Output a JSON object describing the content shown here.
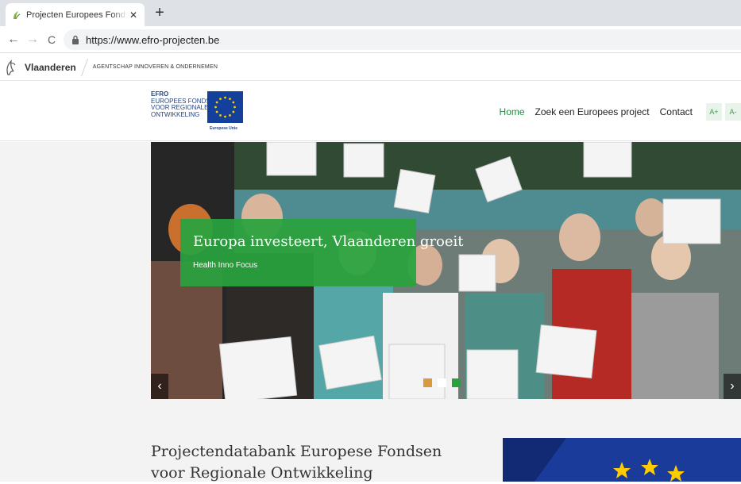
{
  "browser": {
    "tab_title": "Projecten Europees Fonds voor Regionale Ontwikkeling",
    "close_glyph": "✕",
    "newtab_glyph": "+",
    "back_glyph": "←",
    "forward_glyph": "→",
    "reload_glyph": "C",
    "url": "https://www.efro-projecten.be"
  },
  "vlaanderen_bar": {
    "name": "Vlaanderen",
    "agency": "AGENTSCHAP INNOVEREN & ONDERNEMEN"
  },
  "header": {
    "logo_lines": [
      "EFRO",
      "EUROPEES FONDS",
      "VOOR REGIONALE",
      "ONTWIKKELING"
    ],
    "eu_label": "Europese Unie",
    "nav": [
      {
        "label": "Home",
        "active": true
      },
      {
        "label": "Zoek een Europees project",
        "active": false
      },
      {
        "label": "Contact",
        "active": false
      }
    ],
    "font_increase": "A+",
    "font_decrease": "A-"
  },
  "hero": {
    "caption_title": "Europa investeert, Vlaanderen groeit",
    "caption_subtitle": "Health Inno Focus",
    "prev_glyph": "‹",
    "next_glyph": "›",
    "slides": 3,
    "active_slide": 3
  },
  "intro": {
    "title": "Projectendatabank Europese Fondsen voor Regionale Ontwikkeling"
  },
  "colors": {
    "accent_green": "#29a23e",
    "eu_blue": "#12409a",
    "efro_text": "#27467f"
  }
}
